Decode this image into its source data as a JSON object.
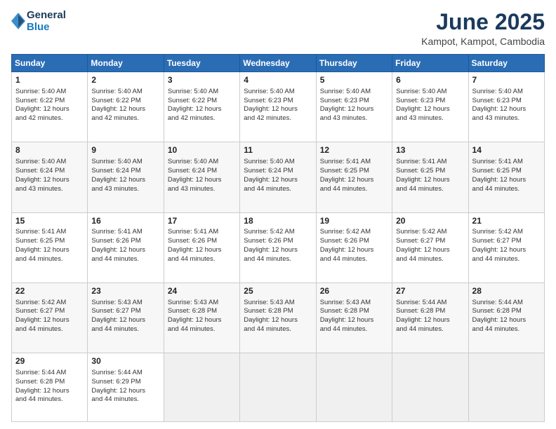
{
  "logo": {
    "line1": "General",
    "line2": "Blue"
  },
  "title": "June 2025",
  "location": "Kampot, Kampot, Cambodia",
  "days_header": [
    "Sunday",
    "Monday",
    "Tuesday",
    "Wednesday",
    "Thursday",
    "Friday",
    "Saturday"
  ],
  "weeks": [
    [
      {
        "day": "1",
        "info": "Sunrise: 5:40 AM\nSunset: 6:22 PM\nDaylight: 12 hours\nand 42 minutes."
      },
      {
        "day": "2",
        "info": "Sunrise: 5:40 AM\nSunset: 6:22 PM\nDaylight: 12 hours\nand 42 minutes."
      },
      {
        "day": "3",
        "info": "Sunrise: 5:40 AM\nSunset: 6:22 PM\nDaylight: 12 hours\nand 42 minutes."
      },
      {
        "day": "4",
        "info": "Sunrise: 5:40 AM\nSunset: 6:23 PM\nDaylight: 12 hours\nand 42 minutes."
      },
      {
        "day": "5",
        "info": "Sunrise: 5:40 AM\nSunset: 6:23 PM\nDaylight: 12 hours\nand 43 minutes."
      },
      {
        "day": "6",
        "info": "Sunrise: 5:40 AM\nSunset: 6:23 PM\nDaylight: 12 hours\nand 43 minutes."
      },
      {
        "day": "7",
        "info": "Sunrise: 5:40 AM\nSunset: 6:23 PM\nDaylight: 12 hours\nand 43 minutes."
      }
    ],
    [
      {
        "day": "8",
        "info": "Sunrise: 5:40 AM\nSunset: 6:24 PM\nDaylight: 12 hours\nand 43 minutes."
      },
      {
        "day": "9",
        "info": "Sunrise: 5:40 AM\nSunset: 6:24 PM\nDaylight: 12 hours\nand 43 minutes."
      },
      {
        "day": "10",
        "info": "Sunrise: 5:40 AM\nSunset: 6:24 PM\nDaylight: 12 hours\nand 43 minutes."
      },
      {
        "day": "11",
        "info": "Sunrise: 5:40 AM\nSunset: 6:24 PM\nDaylight: 12 hours\nand 44 minutes."
      },
      {
        "day": "12",
        "info": "Sunrise: 5:41 AM\nSunset: 6:25 PM\nDaylight: 12 hours\nand 44 minutes."
      },
      {
        "day": "13",
        "info": "Sunrise: 5:41 AM\nSunset: 6:25 PM\nDaylight: 12 hours\nand 44 minutes."
      },
      {
        "day": "14",
        "info": "Sunrise: 5:41 AM\nSunset: 6:25 PM\nDaylight: 12 hours\nand 44 minutes."
      }
    ],
    [
      {
        "day": "15",
        "info": "Sunrise: 5:41 AM\nSunset: 6:25 PM\nDaylight: 12 hours\nand 44 minutes."
      },
      {
        "day": "16",
        "info": "Sunrise: 5:41 AM\nSunset: 6:26 PM\nDaylight: 12 hours\nand 44 minutes."
      },
      {
        "day": "17",
        "info": "Sunrise: 5:41 AM\nSunset: 6:26 PM\nDaylight: 12 hours\nand 44 minutes."
      },
      {
        "day": "18",
        "info": "Sunrise: 5:42 AM\nSunset: 6:26 PM\nDaylight: 12 hours\nand 44 minutes."
      },
      {
        "day": "19",
        "info": "Sunrise: 5:42 AM\nSunset: 6:26 PM\nDaylight: 12 hours\nand 44 minutes."
      },
      {
        "day": "20",
        "info": "Sunrise: 5:42 AM\nSunset: 6:27 PM\nDaylight: 12 hours\nand 44 minutes."
      },
      {
        "day": "21",
        "info": "Sunrise: 5:42 AM\nSunset: 6:27 PM\nDaylight: 12 hours\nand 44 minutes."
      }
    ],
    [
      {
        "day": "22",
        "info": "Sunrise: 5:42 AM\nSunset: 6:27 PM\nDaylight: 12 hours\nand 44 minutes."
      },
      {
        "day": "23",
        "info": "Sunrise: 5:43 AM\nSunset: 6:27 PM\nDaylight: 12 hours\nand 44 minutes."
      },
      {
        "day": "24",
        "info": "Sunrise: 5:43 AM\nSunset: 6:28 PM\nDaylight: 12 hours\nand 44 minutes."
      },
      {
        "day": "25",
        "info": "Sunrise: 5:43 AM\nSunset: 6:28 PM\nDaylight: 12 hours\nand 44 minutes."
      },
      {
        "day": "26",
        "info": "Sunrise: 5:43 AM\nSunset: 6:28 PM\nDaylight: 12 hours\nand 44 minutes."
      },
      {
        "day": "27",
        "info": "Sunrise: 5:44 AM\nSunset: 6:28 PM\nDaylight: 12 hours\nand 44 minutes."
      },
      {
        "day": "28",
        "info": "Sunrise: 5:44 AM\nSunset: 6:28 PM\nDaylight: 12 hours\nand 44 minutes."
      }
    ],
    [
      {
        "day": "29",
        "info": "Sunrise: 5:44 AM\nSunset: 6:28 PM\nDaylight: 12 hours\nand 44 minutes."
      },
      {
        "day": "30",
        "info": "Sunrise: 5:44 AM\nSunset: 6:29 PM\nDaylight: 12 hours\nand 44 minutes."
      },
      {
        "day": "",
        "info": ""
      },
      {
        "day": "",
        "info": ""
      },
      {
        "day": "",
        "info": ""
      },
      {
        "day": "",
        "info": ""
      },
      {
        "day": "",
        "info": ""
      }
    ]
  ]
}
